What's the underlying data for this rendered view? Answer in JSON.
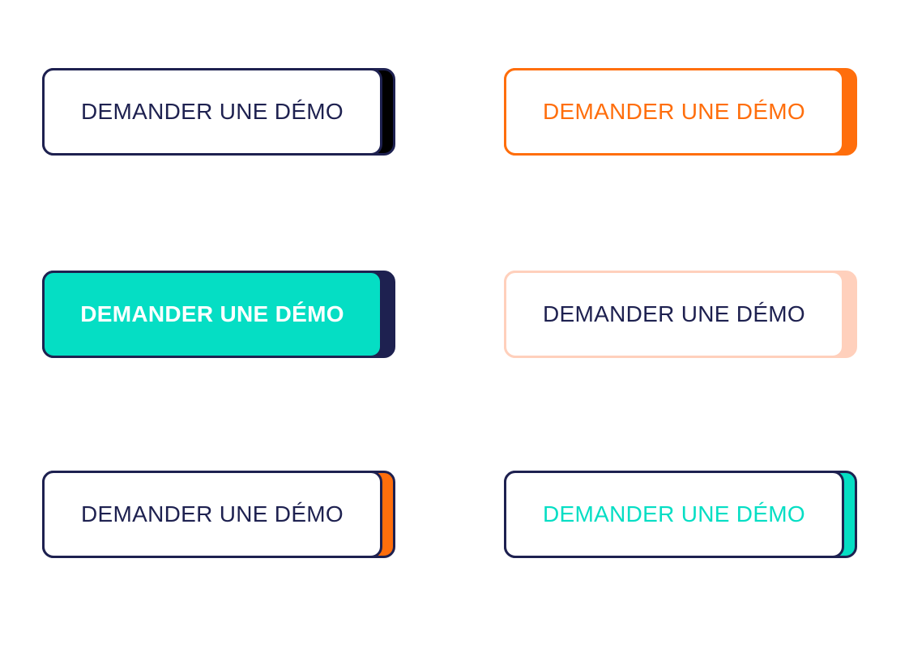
{
  "buttons": [
    {
      "label": "DEMANDER UNE DÉMO",
      "face_bg": "#ffffff",
      "face_border": "#1e2150",
      "text_color": "#1e2150",
      "shadow_color": "#000000",
      "shadow_border": "#1e2150",
      "bold": false
    },
    {
      "label": "DEMANDER UNE DÉMO",
      "face_bg": "#ffffff",
      "face_border": "#ff6e0c",
      "text_color": "#ff6e0c",
      "shadow_color": "#ff6e0c",
      "shadow_border": "#ff6e0c",
      "bold": false
    },
    {
      "label": "DEMANDER UNE DÉMO",
      "face_bg": "#05dec4",
      "face_border": "#1e2150",
      "text_color": "#ffffff",
      "shadow_color": "#1e2150",
      "shadow_border": "#1e2150",
      "bold": true
    },
    {
      "label": "DEMANDER UNE DÉMO",
      "face_bg": "#ffffff",
      "face_border": "#ffd0bc",
      "text_color": "#1e2150",
      "shadow_color": "#ffd0bc",
      "shadow_border": "#ffd0bc",
      "bold": false
    },
    {
      "label": "DEMANDER UNE DÉMO",
      "face_bg": "#ffffff",
      "face_border": "#1e2150",
      "text_color": "#1e2150",
      "shadow_color": "#ff6e0c",
      "shadow_border": "#1e2150",
      "bold": false
    },
    {
      "label": "DEMANDER UNE DÉMO",
      "face_bg": "#ffffff",
      "face_border": "#1e2150",
      "text_color": "#05dec4",
      "shadow_color": "#05dec4",
      "shadow_border": "#1e2150",
      "bold": false
    }
  ]
}
